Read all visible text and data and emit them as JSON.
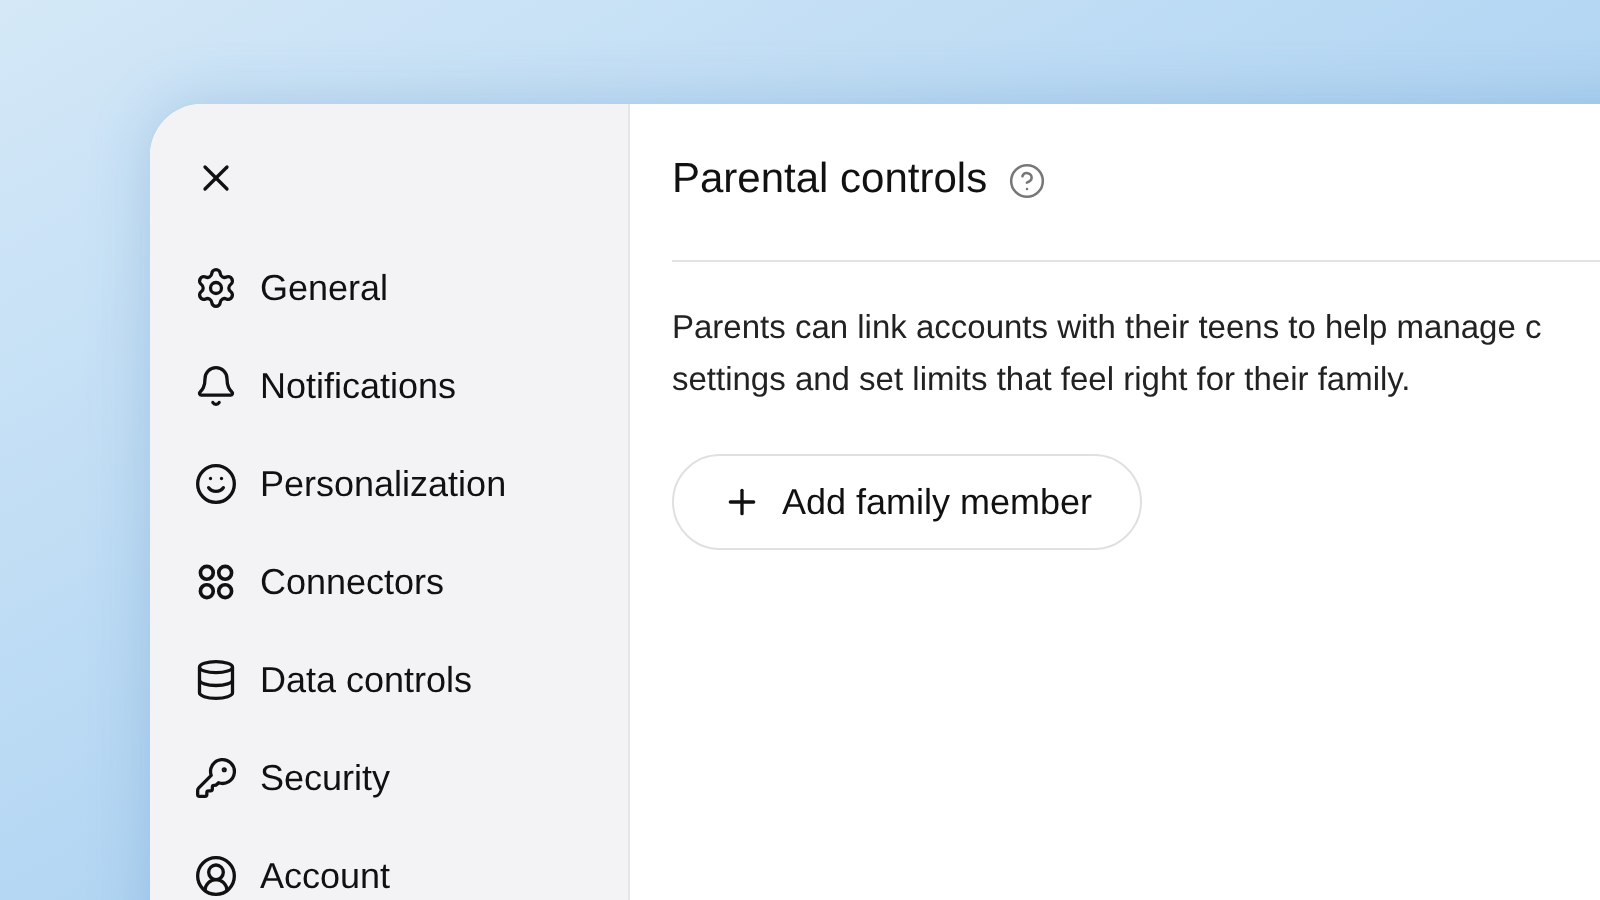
{
  "sidebar": {
    "items": [
      {
        "label": "General"
      },
      {
        "label": "Notifications"
      },
      {
        "label": "Personalization"
      },
      {
        "label": "Connectors"
      },
      {
        "label": "Data controls"
      },
      {
        "label": "Security"
      },
      {
        "label": "Account"
      }
    ]
  },
  "main": {
    "title": "Parental controls",
    "description_lines": [
      "Parents can link accounts with their teens to help manage c",
      "settings and set limits that feel right for their family."
    ],
    "button": "Add family member"
  }
}
